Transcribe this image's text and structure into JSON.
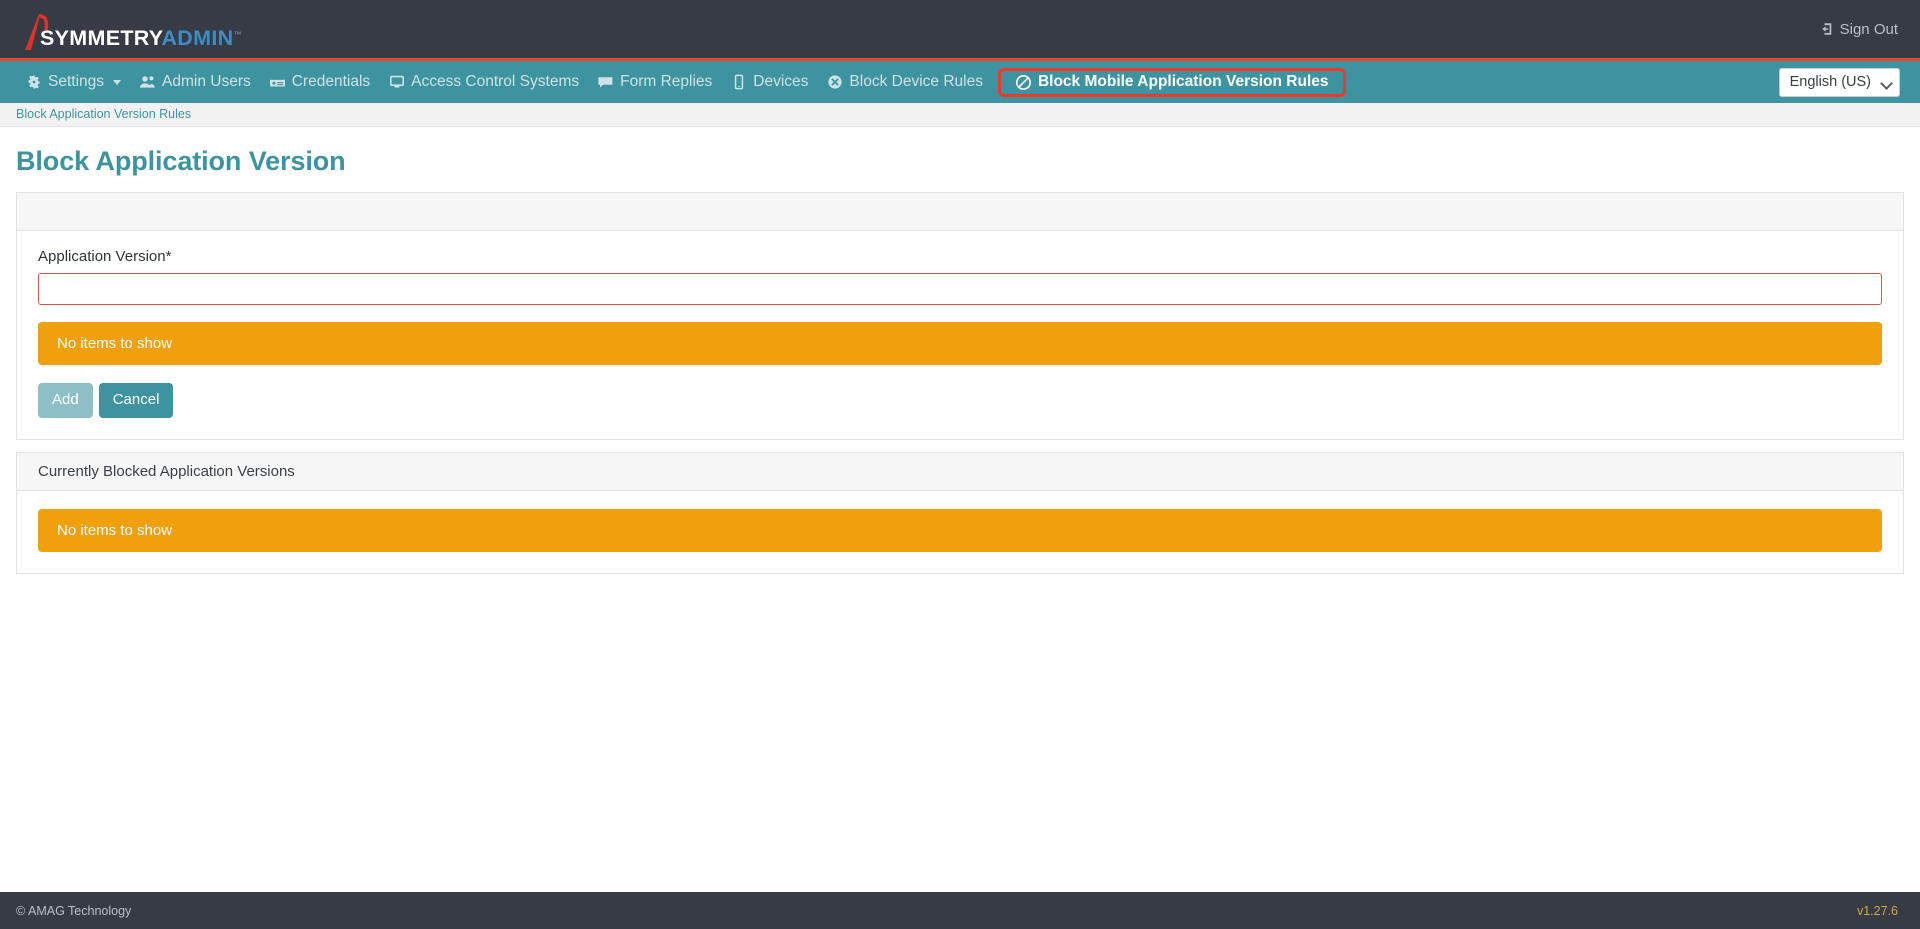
{
  "colors": {
    "topbar_bg": "#363b45",
    "accent_red": "#e8472a",
    "nav_bg": "#3d94a0",
    "teal": "#3d94a0",
    "warning_orange": "#f0a00c",
    "highlight_border": "#f0392b",
    "logo_blue": "#3c8dc5",
    "input_error_border": "#d9534f"
  },
  "topbar": {
    "logo_primary": "SYMMETRY",
    "logo_secondary": "ADMIN",
    "logo_tm": "™",
    "signout_label": "Sign Out",
    "signout_icon": "sign-out-icon"
  },
  "nav": {
    "items": [
      {
        "label": "Settings",
        "icon": "gear-icon",
        "has_caret": true,
        "active": false
      },
      {
        "label": "Admin Users",
        "icon": "users-icon",
        "has_caret": false,
        "active": false
      },
      {
        "label": "Credentials",
        "icon": "id-card-icon",
        "has_caret": false,
        "active": false
      },
      {
        "label": "Access Control Systems",
        "icon": "desktop-icon",
        "has_caret": false,
        "active": false
      },
      {
        "label": "Form Replies",
        "icon": "comment-icon",
        "has_caret": false,
        "active": false
      },
      {
        "label": "Devices",
        "icon": "mobile-icon",
        "has_caret": false,
        "active": false
      },
      {
        "label": "Block Device Rules",
        "icon": "times-circle-icon",
        "has_caret": false,
        "active": false
      },
      {
        "label": "Block Mobile Application Version Rules",
        "icon": "ban-icon",
        "has_caret": false,
        "active": true
      }
    ],
    "language": {
      "selected": "English (US)",
      "icon": "chevron-down-icon"
    }
  },
  "breadcrumb": {
    "items": [
      "Block Application Version Rules"
    ]
  },
  "main": {
    "page_title": "Block Application Version",
    "add_panel": {
      "header": "",
      "field_label": "Application Version*",
      "field_value": "",
      "field_placeholder": "",
      "empty_message": "No items to show",
      "buttons": {
        "add": "Add",
        "cancel": "Cancel"
      }
    },
    "blocked_panel": {
      "header": "Currently Blocked Application Versions",
      "empty_message": "No items to show"
    }
  },
  "footer": {
    "copyright": "© AMAG Technology",
    "version": "v1.27.6"
  }
}
